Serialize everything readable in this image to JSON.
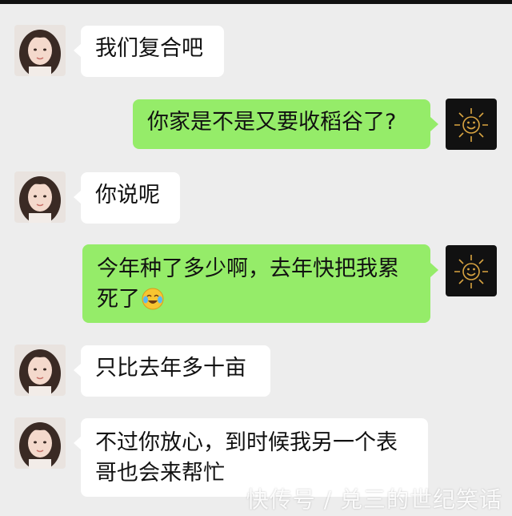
{
  "chat": {
    "messages": [
      {
        "side": "in",
        "text": "我们复合吧"
      },
      {
        "side": "out",
        "text": "你家是不是又要收稻谷了?"
      },
      {
        "side": "in",
        "text": "你说呢"
      },
      {
        "side": "out",
        "text": "今年种了多少啊，去年快把我累死了",
        "emoji": "crying-laughing-emoji"
      },
      {
        "side": "in",
        "text": "只比去年多十亩"
      },
      {
        "side": "in",
        "text": "不过你放心，到时候我另一个表哥也会来帮忙"
      }
    ]
  },
  "watermark": "快传号 / 兑三的世纪笑话",
  "colors": {
    "background": "#ededed",
    "incoming_bubble": "#ffffff",
    "outgoing_bubble": "#95ec69",
    "sun_avatar_bg": "#111111",
    "sun_avatar_line": "#d9a441"
  }
}
